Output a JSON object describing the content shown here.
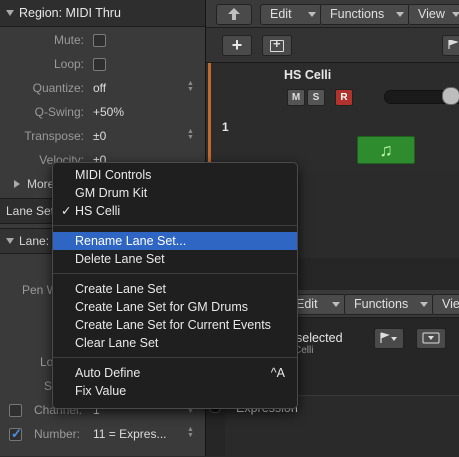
{
  "inspector": {
    "region_title": "Region: MIDI Thru",
    "params": [
      {
        "label": "Mute:",
        "value": "",
        "kind": "checkbox"
      },
      {
        "label": "Loop:",
        "value": "",
        "kind": "checkbox"
      },
      {
        "label": "Quantize:",
        "value": "off",
        "kind": "stepper"
      },
      {
        "label": "Q-Swing:",
        "value": "+50%",
        "kind": "text"
      },
      {
        "label": "Transpose:",
        "value": "±0",
        "kind": "stepper"
      },
      {
        "label": "Velocity:",
        "value": "±0",
        "kind": "text"
      }
    ],
    "more_label": "More",
    "lane_set_label": "Lane Set",
    "lane_label": "Lane:",
    "pen_label": "Pen W",
    "lo_label": "Lo",
    "s_label": "S",
    "channel": {
      "label": "Channel:",
      "value": "1"
    },
    "number": {
      "label": "Number:",
      "value": "11 = Expres..."
    }
  },
  "toolbar": {
    "edit_label": "Edit",
    "functions_label": "Functions",
    "view_label": "View"
  },
  "track": {
    "number": "1",
    "name": "HS Celli",
    "mute": "M",
    "solo": "S",
    "record": "R"
  },
  "lower": {
    "edit_label": "Edit",
    "functions_label": "Functions",
    "view_label": "View",
    "selected_text": "selected",
    "sub_text": "Celli",
    "lane_name": "Expression"
  },
  "menu": {
    "items": [
      {
        "label": "MIDI Controls",
        "checked": false
      },
      {
        "label": "GM Drum Kit",
        "checked": false
      },
      {
        "label": "HS Celli",
        "checked": true,
        "check_mark": "✓"
      },
      {
        "label": "Rename Lane Set...",
        "highlighted": true
      },
      {
        "label": "Delete Lane Set"
      },
      {
        "label": "Create Lane Set"
      },
      {
        "label": "Create Lane Set for GM Drums"
      },
      {
        "label": "Create Lane Set for Current Events"
      },
      {
        "label": "Clear Lane Set"
      },
      {
        "label": "Auto Define",
        "shortcut": "^A"
      },
      {
        "label": "Fix Value"
      }
    ]
  },
  "colors": {
    "menu_highlight": "#2f66c4",
    "track_color": "#c06a2b",
    "record_red": "#b1332e",
    "region_green": "#2e8b2e",
    "checkbox_blue": "#4b8fe0"
  }
}
